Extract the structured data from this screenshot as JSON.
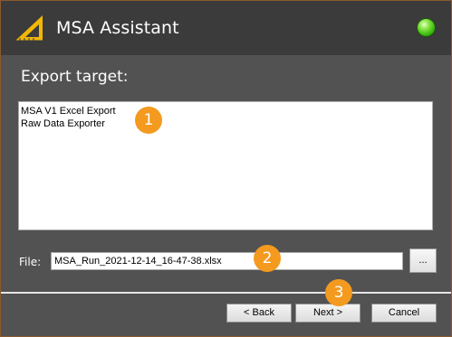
{
  "window": {
    "title": "MSA Assistant",
    "logo_icon": "set-square-ruler-icon",
    "status_indicator": {
      "icon": "green-status-led",
      "color": "#4cc61a"
    }
  },
  "export": {
    "heading": "Export target:",
    "targets": [
      "MSA V1 Excel Export",
      "Raw Data Exporter"
    ]
  },
  "file": {
    "label": "File:",
    "value": "MSA_Run_2021-12-14_16-47-38.xlsx",
    "browse_label": "..."
  },
  "buttons": {
    "back": "< Back",
    "next": "Next >",
    "cancel": "Cancel"
  },
  "callouts": [
    "1",
    "2",
    "3"
  ],
  "colors": {
    "title_bar": "#3b3b3b",
    "window_body": "#525252",
    "window_border": "#8a5a2e",
    "callout": "#f39a1f",
    "logo": "#f2b705"
  }
}
